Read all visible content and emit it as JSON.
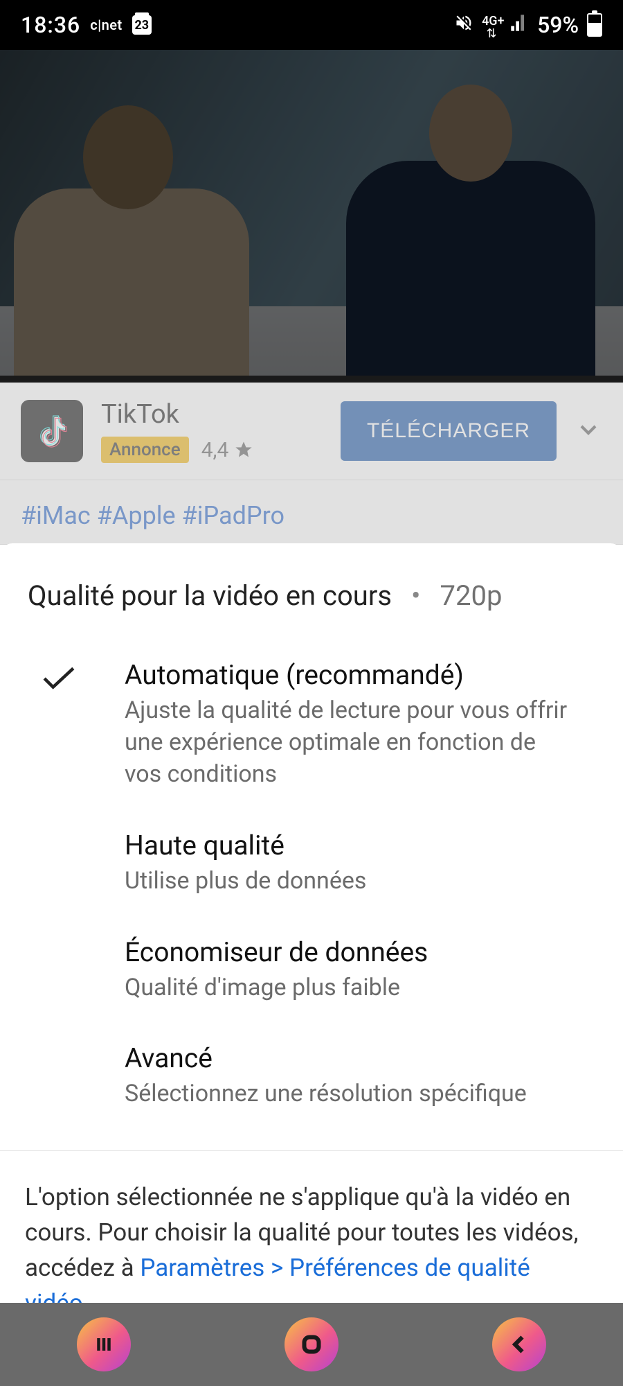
{
  "status": {
    "time": "18:36",
    "cnet": "c|net",
    "calendar_day": "23",
    "network": "4G+",
    "battery_pct": "59%"
  },
  "ad": {
    "title": "TikTok",
    "badge": "Annonce",
    "rating": "4,4",
    "cta": "TÉLÉCHARGER"
  },
  "hashtags": "#iMac #Apple #iPadPro",
  "sheet": {
    "title": "Qualité pour la vidéo en cours",
    "current": "720p",
    "options": [
      {
        "title": "Automatique (recommandé)",
        "sub": "Ajuste la qualité de lecture pour vous offrir une expérience optimale en fonction de vos conditions",
        "selected": true
      },
      {
        "title": "Haute qualité",
        "sub": "Utilise plus de données",
        "selected": false
      },
      {
        "title": "Économiseur de données",
        "sub": "Qualité d'image plus faible",
        "selected": false
      },
      {
        "title": "Avancé",
        "sub": "Sélectionnez une résolution spécifique",
        "selected": false
      }
    ],
    "footer_prefix": "L'option sélectionnée ne s'applique qu'à la vidéo en cours. Pour choisir la qualité pour toutes les vidéos, accédez à ",
    "footer_link": "Paramètres > Préférences de qualité vidéo",
    "footer_suffix": "."
  }
}
